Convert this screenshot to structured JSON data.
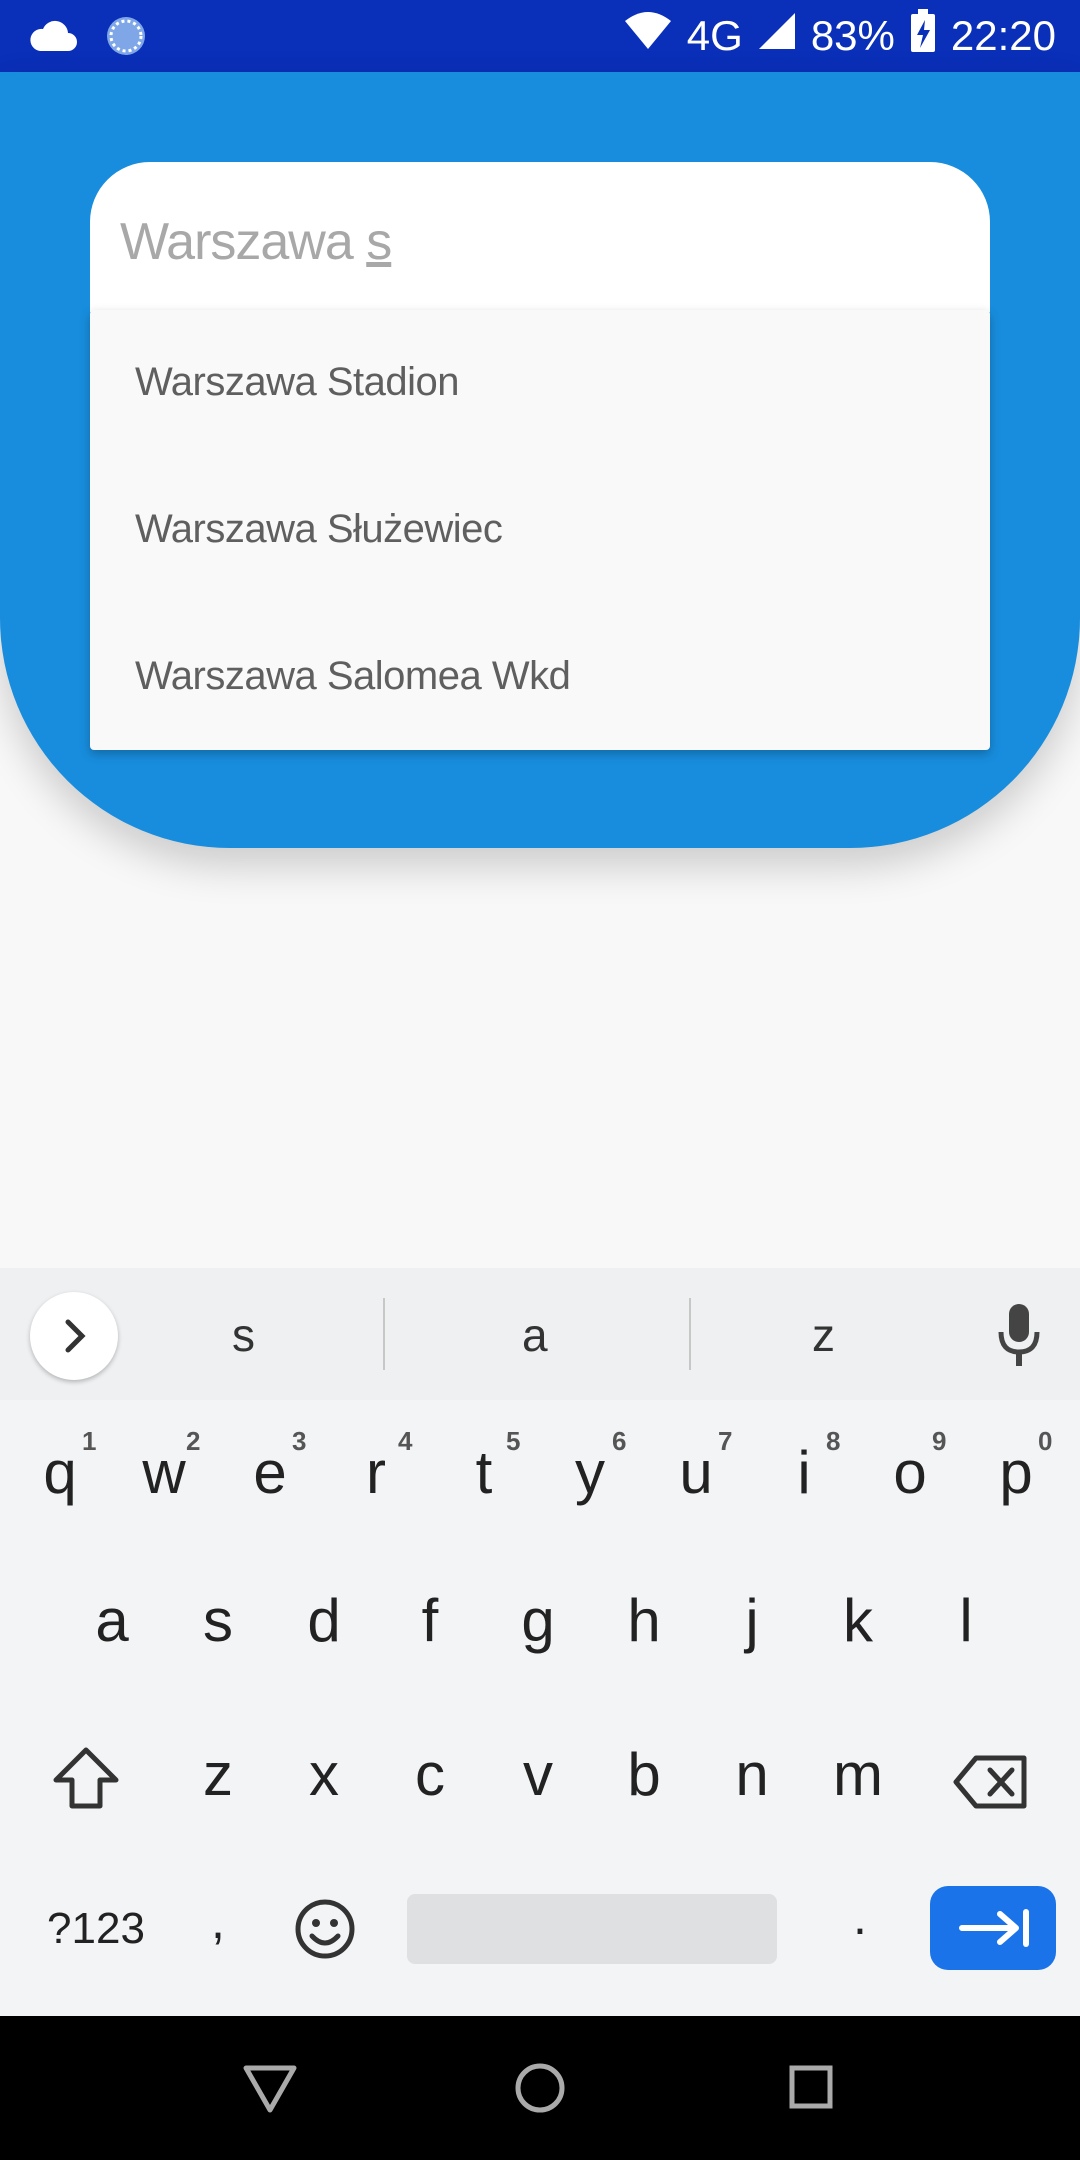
{
  "status_bar": {
    "icons_left": [
      "cloud-icon",
      "sync-icon"
    ],
    "network": "4G",
    "battery": "83%",
    "time": "22:20"
  },
  "search": {
    "value_prefix": "Warszawa ",
    "value_typed": "s"
  },
  "suggestions_dropdown": [
    "Warszawa Stadion",
    "Warszawa Służewiec",
    "Warszawa Salomea Wkd"
  ],
  "keyboard": {
    "suggestions": [
      "s",
      "a",
      "z"
    ],
    "row1": [
      "q",
      "w",
      "e",
      "r",
      "t",
      "y",
      "u",
      "i",
      "o",
      "p"
    ],
    "row1_hints": [
      "1",
      "2",
      "3",
      "4",
      "5",
      "6",
      "7",
      "8",
      "9",
      "0"
    ],
    "row2": [
      "a",
      "s",
      "d",
      "f",
      "g",
      "h",
      "j",
      "k",
      "l"
    ],
    "row3": [
      "z",
      "x",
      "c",
      "v",
      "b",
      "n",
      "m"
    ],
    "symbols_label": "?123",
    "comma": ",",
    "period": "."
  },
  "colors": {
    "status_bar": "#0a2fb8",
    "header": "#188ddd",
    "enter_key": "#1a73e8"
  }
}
